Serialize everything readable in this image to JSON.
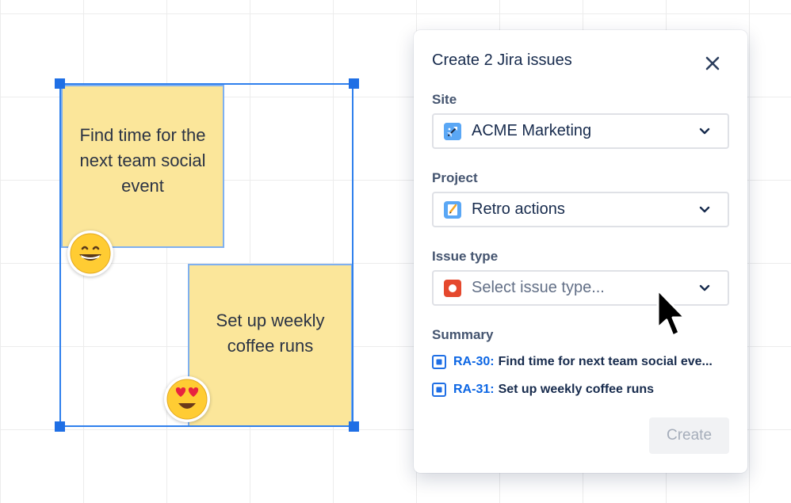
{
  "canvas": {
    "sticky_notes": [
      {
        "text": "Find time for the next team social event",
        "color": "#fbe69a"
      },
      {
        "text": "Set up weekly coffee runs",
        "color": "#fbe69a"
      }
    ],
    "reactions": [
      {
        "icon": "grinning-face-emoji"
      },
      {
        "icon": "heart-eyes-emoji"
      }
    ]
  },
  "modal": {
    "title": "Create 2 Jira issues",
    "close_icon": "close-icon",
    "site": {
      "label": "Site",
      "value": "ACME Marketing",
      "icon": "site-rocket-icon"
    },
    "project": {
      "label": "Project",
      "value": "Retro actions",
      "icon": "project-notebook-icon"
    },
    "issue_type": {
      "label": "Issue type",
      "placeholder": "Select issue type...",
      "icon": "issue-type-icon"
    },
    "summary": {
      "label": "Summary",
      "items": [
        {
          "key": "RA-30:",
          "text": "Find time for next team social eve..."
        },
        {
          "key": "RA-31:",
          "text": "Set up weekly coffee runs"
        }
      ]
    },
    "create_label": "Create"
  },
  "colors": {
    "selection": "#2f80ed",
    "link": "#0c66e4",
    "sticky": "#fbe69a"
  }
}
